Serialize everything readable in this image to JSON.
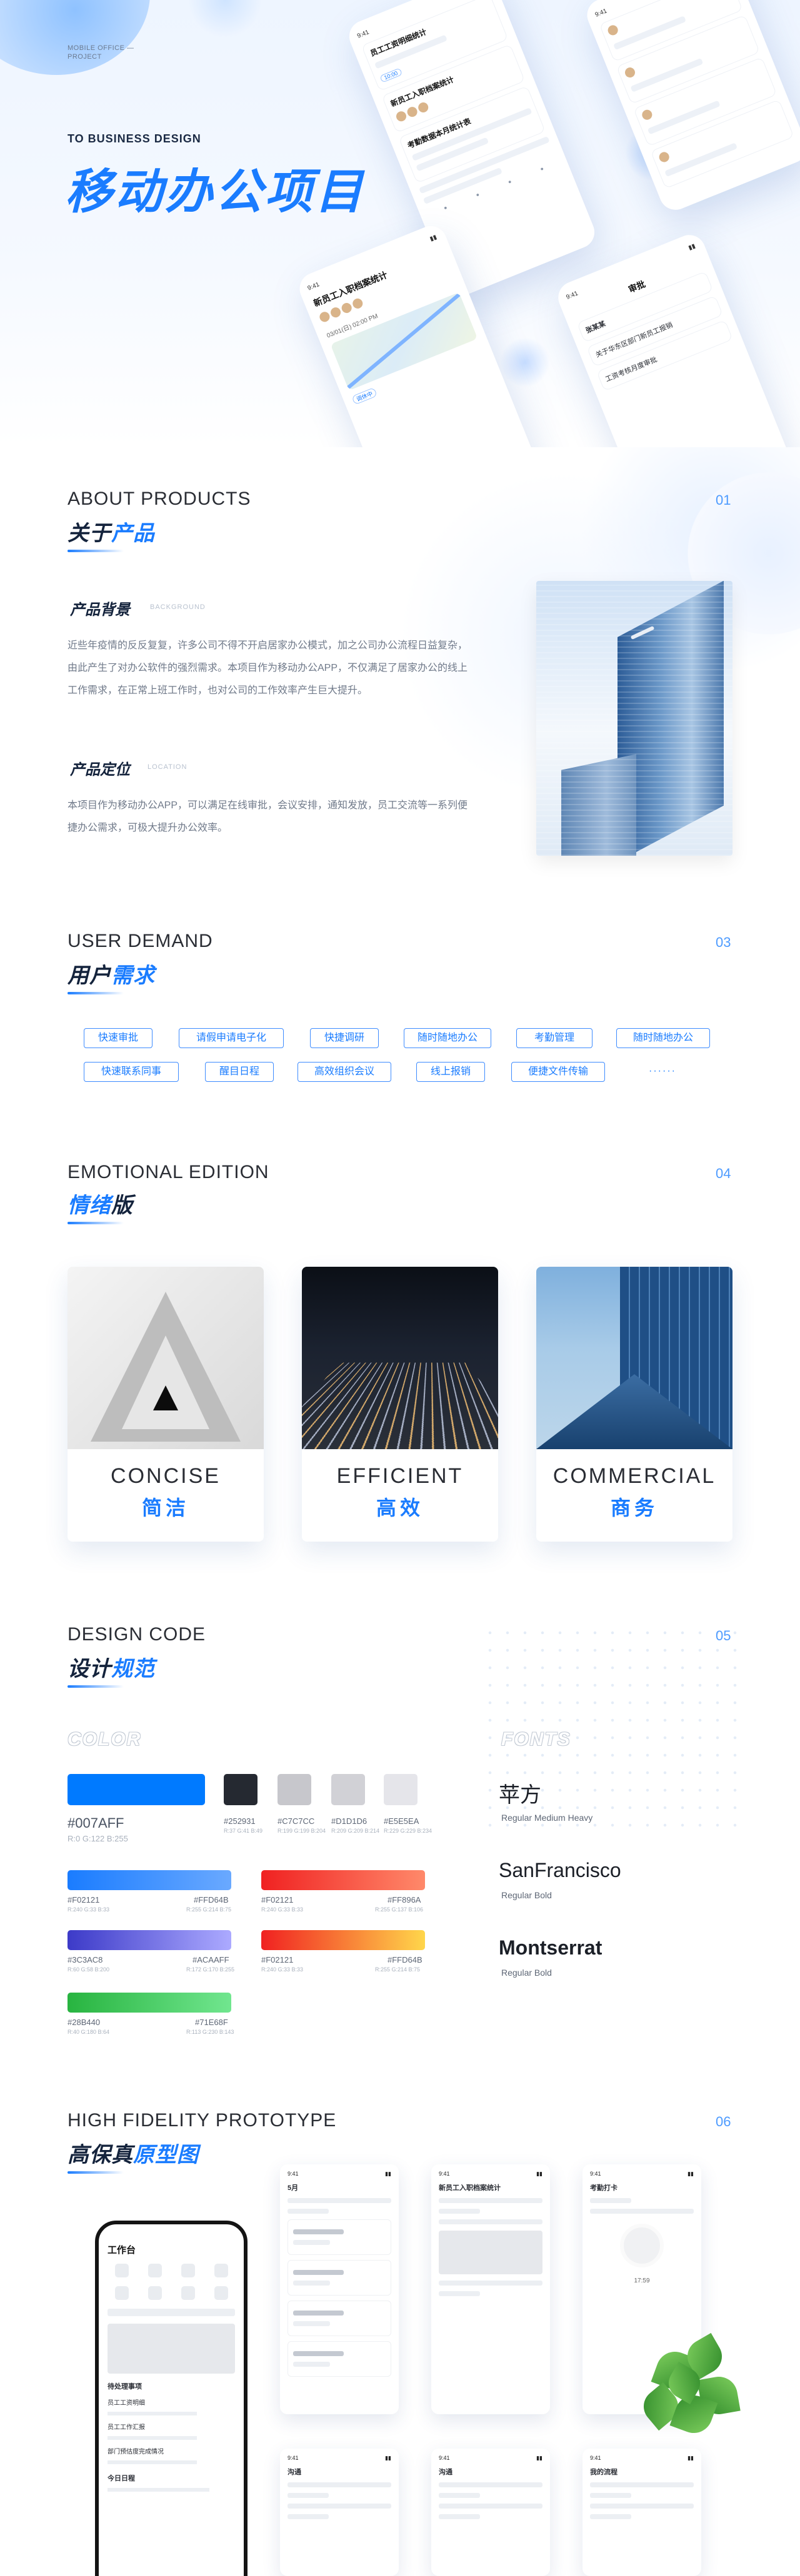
{
  "hero": {
    "subtitle": "MOBILE OFFICE — PROJECT",
    "kicker": "TO BUSINESS DESIGN",
    "title": "移动办公项目",
    "phone_texts": {
      "time": "9:41",
      "p1_item1": "员工工资明细统计",
      "p1_item2": "新员工入职档案统计",
      "p1_item3": "考勤数据本月统计表",
      "p1_tag": "10:00",
      "p3_title": "新员工入职档案统计",
      "p3_time": "03/01(日) 02:00 PM",
      "p3_tag": "调休中",
      "p4_title": "审批",
      "p4_item1": "张某某",
      "p4_item2": "关于华东区部门新员工报销",
      "p4_item3": "工资考核月度审批"
    }
  },
  "about": {
    "en": "ABOUT PRODUCTS",
    "cn_a": "关于",
    "cn_b": "产品",
    "num": "01",
    "bg_title": "产品背景",
    "bg_tag": "BACKGROUND",
    "bg_text": "近些年疫情的反反复复，许多公司不得不开启居家办公模式，加之公司办公流程日益复杂，由此产生了对办公软件的强烈需求。本项目作为移动办公APP，不仅满足了居家办公的线上工作需求，在正常上班工作时，也对公司的工作效率产生巨大提升。",
    "pos_title": "产品定位",
    "pos_tag": "LOCATION",
    "pos_text": "本项目作为移动办公APP，可以满足在线审批，会议安排，通知发放，员工交流等一系列便捷办公需求，可极大提升办公效率。"
  },
  "demand": {
    "en": "USER DEMAND",
    "cn_a": "用户",
    "cn_b": "需求",
    "num": "03",
    "tags": [
      "快速审批",
      "请假申请电子化",
      "快捷调研",
      "随时随地办公",
      "考勤管理",
      "随时随地办公",
      "快速联系同事",
      "醒目日程",
      "高效组织会议",
      "线上报销",
      "便捷文件传输",
      "······"
    ]
  },
  "emotional": {
    "en": "EMOTIONAL EDITION",
    "cn_a": "情绪",
    "cn_b": "版",
    "num": "04",
    "cards": [
      {
        "en": "CONCISE",
        "cn": "简洁"
      },
      {
        "en": "EFFICIENT",
        "cn": "高效"
      },
      {
        "en": "COMMERCIAL",
        "cn": "商务"
      }
    ]
  },
  "design": {
    "en": "DESIGN CODE",
    "cn_a": "设计",
    "cn_b": "规范",
    "num": "05",
    "color_label": "COLOR",
    "fonts_label": "FONTS",
    "primary": {
      "hex": "#007AFF",
      "rgb": "R:0 G:122 B:255",
      "color": "#007AFF"
    },
    "neutrals": [
      {
        "hex": "#252931",
        "rgb": "R:37 G:41 B:49",
        "color": "#252931"
      },
      {
        "hex": "#C7C7CC",
        "rgb": "R:199 G:199 B:204",
        "color": "#C7C7CC"
      },
      {
        "hex": "#D1D1D6",
        "rgb": "R:209 G:209 B:214",
        "color": "#D1D1D6"
      },
      {
        "hex": "#E5E5EA",
        "rgb": "R:229 G:229 B:234",
        "color": "#E5E5EA"
      }
    ],
    "gradients": [
      {
        "from": "#F02121",
        "to": "#FF896A",
        "a": "#F02121",
        "b": "#FF896A",
        "ra": "R:240 G:33 B:33",
        "rb": "R:255 G:137 B:106"
      },
      {
        "from": "#F02121",
        "to": "#FFD64B",
        "a": "#F02121",
        "b": "#FFD64B",
        "ra": "R:240 G:33 B:33",
        "rb": "R:255 G:214 B:75"
      }
    ],
    "gradients_left": [
      {
        "a": "#F02121",
        "b": "#FFD64B",
        "ra": "R:240 G:33 B:33",
        "rb": "R:255 G:214 B:75",
        "c1": "#1a7cff",
        "c2": "#6aa9ff"
      },
      {
        "a": "#3C3AC8",
        "b": "#ACAAFF",
        "ra": "R:60 G:58 B:200",
        "rb": "R:172 G:170 B:255",
        "c1": "#3C3AC8",
        "c2": "#ACAAFF"
      },
      {
        "a": "#28B440",
        "b": "#71E68F",
        "ra": "R:40 G:180 B:64",
        "rb": "R:113 G:230 B:143",
        "c1": "#28B440",
        "c2": "#71E68F"
      }
    ],
    "fonts": [
      {
        "name": "苹方",
        "weights": "Regular   Medium   Heavy"
      },
      {
        "name": "SanFrancisco",
        "weights": "Regular   Bold"
      },
      {
        "name": "Montserrat",
        "weights": "Regular   Bold"
      }
    ]
  },
  "prototype": {
    "en": "HIGH FIDELITY PROTOTYPE",
    "cn_a": "高保真",
    "cn_b": "原型图",
    "num": "06",
    "big_title": "工作台",
    "big_section1": "待处理事项",
    "big_item1": "员工工资明细",
    "big_item2": "员工工作汇报",
    "big_item3": "部门预估度完成情况",
    "big_section2": "今日日程",
    "screen1_title": "5月",
    "screen2_title": "新员工入职档案统计",
    "screen3_title": "考勤打卡",
    "screen3_time": "17:59",
    "screen4_title": "沟通",
    "screen5_title": "沟通",
    "screen6_title": "我的流程"
  }
}
